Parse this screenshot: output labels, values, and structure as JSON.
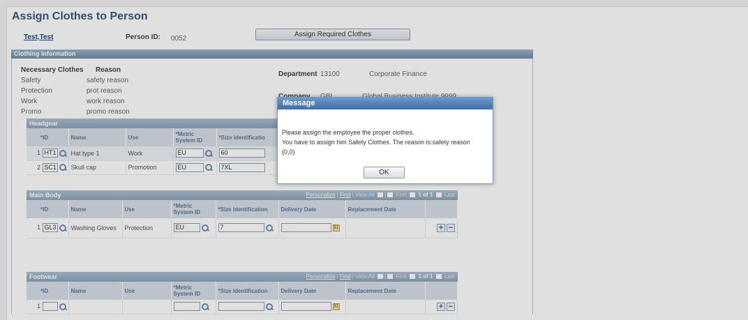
{
  "page": {
    "title": "Assign Clothes to Person",
    "person_name": "Test,Test",
    "person_id_label": "Person ID:",
    "person_id_value": "0052",
    "assign_button": "Assign Required Clothes"
  },
  "clothing": {
    "section_title": "Clothing Information",
    "necessary_header": "Necessary Clothes",
    "reason_header": "Reason",
    "rows": [
      {
        "name": "Safety",
        "reason": "safety reason"
      },
      {
        "name": "Protection",
        "reason": "prot reason"
      },
      {
        "name": "Work",
        "reason": "work reason"
      },
      {
        "name": "Promo",
        "reason": "promo reason"
      }
    ],
    "department_label": "Department",
    "department_code": "13100",
    "department_name": "Corporate Finance",
    "company_label": "Company",
    "company_code": "GBI",
    "company_name": "Global Business Institute 9999"
  },
  "headgear": {
    "title": "Headgear",
    "columns": [
      "*ID",
      "Name",
      "Use",
      "*Metric System ID",
      "*Size Identificatio"
    ],
    "rows": [
      {
        "num": "1",
        "id": "HT1",
        "name": "Hat type 1",
        "use": "Work",
        "metric": "EU",
        "size": "60"
      },
      {
        "num": "2",
        "id": "SC1",
        "name": "Skull cap",
        "use": "Promotion",
        "metric": "EU",
        "size": "7XL"
      }
    ]
  },
  "mainbody": {
    "title": "Main Body",
    "nav": {
      "personalize": "Personalize",
      "find": "Find",
      "view_all": "View All",
      "first": "First",
      "count": "1 of 1",
      "last": "Last"
    },
    "columns": [
      "*ID",
      "Name",
      "Use",
      "*Metric System ID",
      "*Size Identification",
      "Delivery Date",
      "Replacement Date"
    ],
    "rows": [
      {
        "num": "1",
        "id": "GL3",
        "name": "Washing Gloves",
        "use": "Protection",
        "metric": "EU",
        "size": "7",
        "delivery": "",
        "replacement": ""
      }
    ]
  },
  "footwear": {
    "title": "Footwear",
    "nav": {
      "personalize": "Personalize",
      "find": "Find",
      "view_all": "View All",
      "first": "First",
      "count": "1 of 1",
      "last": "Last"
    },
    "columns": [
      "*ID",
      "Name",
      "Use",
      "*Metric System ID",
      "*Size Identification",
      "Delivery Date",
      "Replacement Date"
    ],
    "rows": [
      {
        "num": "1",
        "id": "",
        "name": "",
        "use": "",
        "metric": "",
        "size": "",
        "delivery": "",
        "replacement": ""
      }
    ]
  },
  "dialog": {
    "title": "Message",
    "line1": "Please assign the employee the proper clothes.",
    "line2": "You have to assign him Safety Clothes. The reason is:safety reason",
    "line3": "(0,0)",
    "ok": "OK"
  },
  "icons": {
    "lookup": "magnifier-icon",
    "calendar": "calendar-icon",
    "add": "plus-icon",
    "remove": "minus-icon"
  }
}
